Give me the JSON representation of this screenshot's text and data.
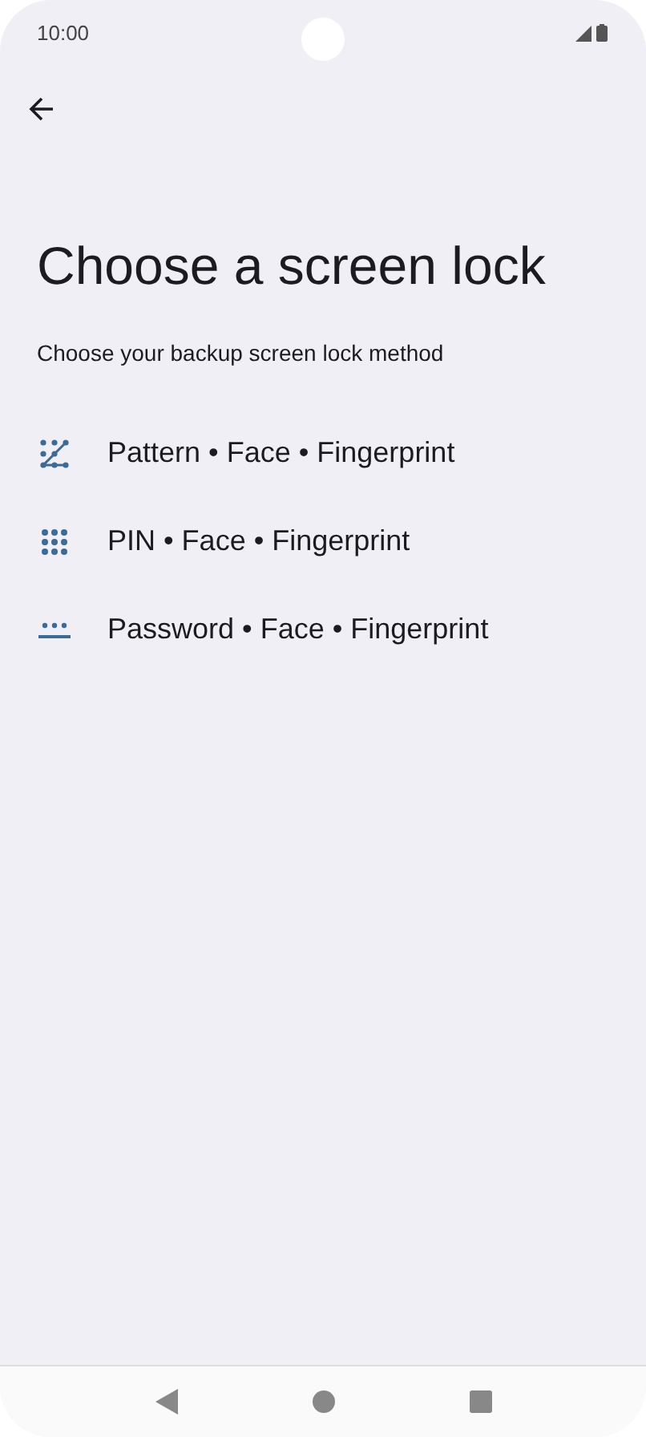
{
  "status_bar": {
    "time": "10:00"
  },
  "title": "Choose a screen lock",
  "subtitle": "Choose your backup screen lock method",
  "options": [
    {
      "kind": "pattern",
      "label": "Pattern • Face • Fingerprint"
    },
    {
      "kind": "pin",
      "label": "PIN • Face • Fingerprint"
    },
    {
      "kind": "password",
      "label": "Password • Face • Fingerprint"
    }
  ]
}
